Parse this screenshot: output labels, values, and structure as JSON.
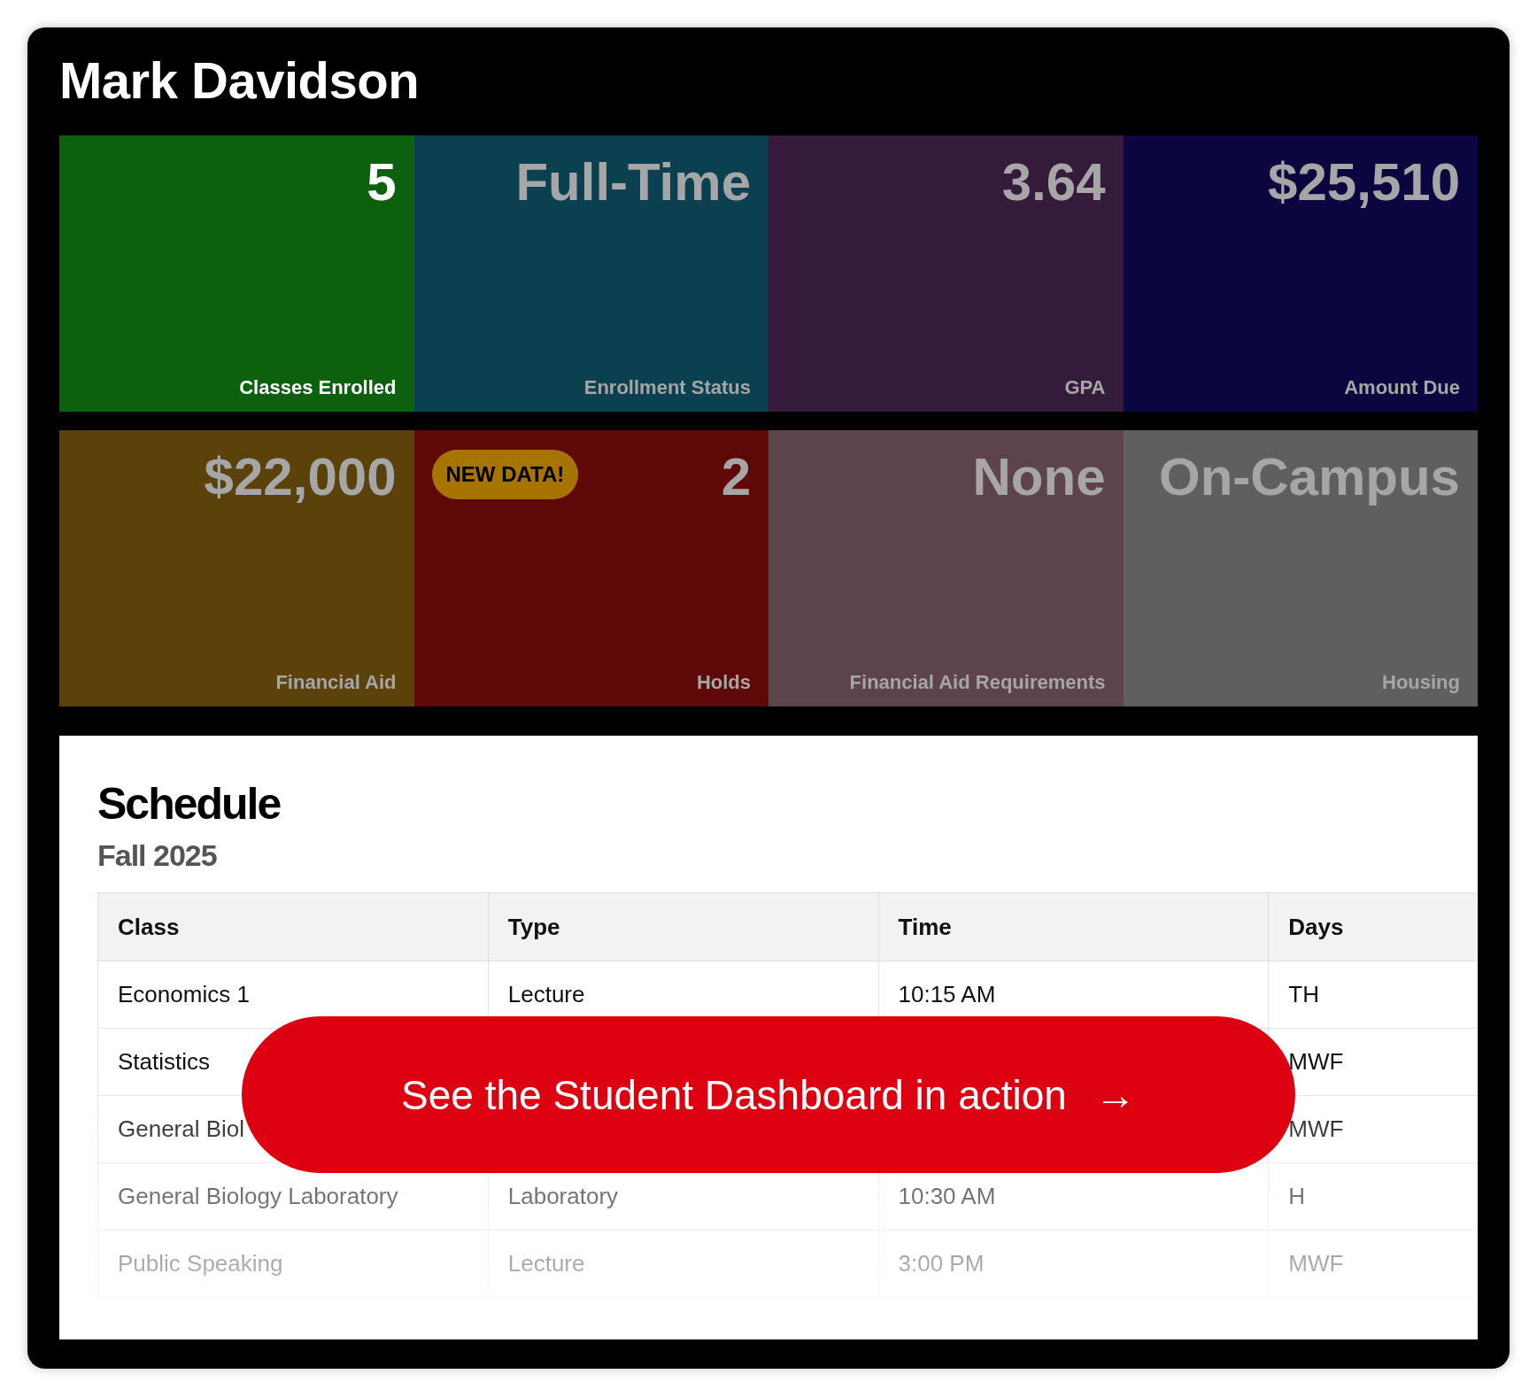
{
  "student": {
    "name": "Mark Davidson"
  },
  "tiles": [
    {
      "value": "5",
      "label": "Classes Enrolled",
      "color": "#0d600d",
      "highlighted": true
    },
    {
      "value": "Full-Time",
      "label": "Enrollment Status",
      "color": "#0a404f",
      "highlighted": false
    },
    {
      "value": "3.64",
      "label": "GPA",
      "color": "#351b3b",
      "highlighted": false
    },
    {
      "value": "$25,510",
      "label": "Amount Due",
      "color": "#0b0640",
      "highlighted": false
    },
    {
      "value": "$22,000",
      "label": "Financial Aid",
      "color": "#5b420b",
      "highlighted": false
    },
    {
      "value": "2",
      "label": "Holds",
      "color": "#5e0808",
      "highlighted": false,
      "badge": "NEW DATA!"
    },
    {
      "value": "None",
      "label": "Financial Aid Requirements",
      "color": "#5c444a",
      "highlighted": false
    },
    {
      "value": "On-Campus",
      "label": "Housing",
      "color": "#5f5f5f",
      "highlighted": false
    }
  ],
  "schedule": {
    "title": "Schedule",
    "term": "Fall 2025",
    "columns": [
      "Class",
      "Type",
      "Time",
      "Days"
    ],
    "rows": [
      {
        "class": "Economics 1",
        "type": "Lecture",
        "time": "10:15 AM",
        "days": "TH"
      },
      {
        "class": "Statistics",
        "days": "MWF"
      },
      {
        "class": "General Biol",
        "days": "MWF"
      },
      {
        "class": "General Biology Laboratory",
        "type": "Laboratory",
        "time": "10:30 AM",
        "days": "H"
      },
      {
        "class": "Public Speaking",
        "type": "Lecture",
        "time": "3:00 PM",
        "days": "MWF"
      }
    ]
  },
  "cta": {
    "label": "See the Student Dashboard in action",
    "arrow": "→"
  }
}
